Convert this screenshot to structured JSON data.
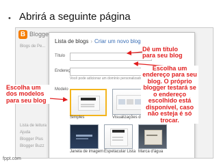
{
  "slide": {
    "bullet": "•",
    "heading": "Abrirá a seguinte página"
  },
  "app": {
    "name": "Blogger",
    "sidebar_items": [
      "Blogs de Pe...",
      "",
      "",
      "",
      "",
      "",
      "Lista de leitura",
      "Ajuda",
      "Blogger Plus",
      "Blogger Buzz"
    ]
  },
  "dialog": {
    "breadcrumb_root": "Lista de blogs",
    "breadcrumb_separator": "›",
    "breadcrumb_current": "Criar um novo blog",
    "title_label": "Título",
    "title_value": "",
    "address_label": "Endereço",
    "address_value": "",
    "address_note": "Você pode adicionar um domínio personalizado depois.",
    "templates_label": "Modelo",
    "templates": [
      {
        "name": "Simples",
        "theme": "light",
        "selected": true
      },
      {
        "name": "Visualizações dinâmicas",
        "theme": "light",
        "selected": false
      },
      {
        "name": "Janela de imagem",
        "theme": "dark",
        "selected": false
      },
      {
        "name": "Espetacular Lista",
        "theme": "light",
        "selected": false
      },
      {
        "name": "Marca d'água",
        "theme": "mid",
        "selected": false
      }
    ]
  },
  "annotations": {
    "titulo": "Dê um título para seu blog",
    "endereco": "Escolha um endereço para seu blog. O próprio blogger testará se o endereço escolhido está disponível, caso não esteja é só trocar.",
    "modelos": "Escolha um dos modelos para seu blog",
    "color": "#e11e1e"
  },
  "watermark": "fppt.com"
}
